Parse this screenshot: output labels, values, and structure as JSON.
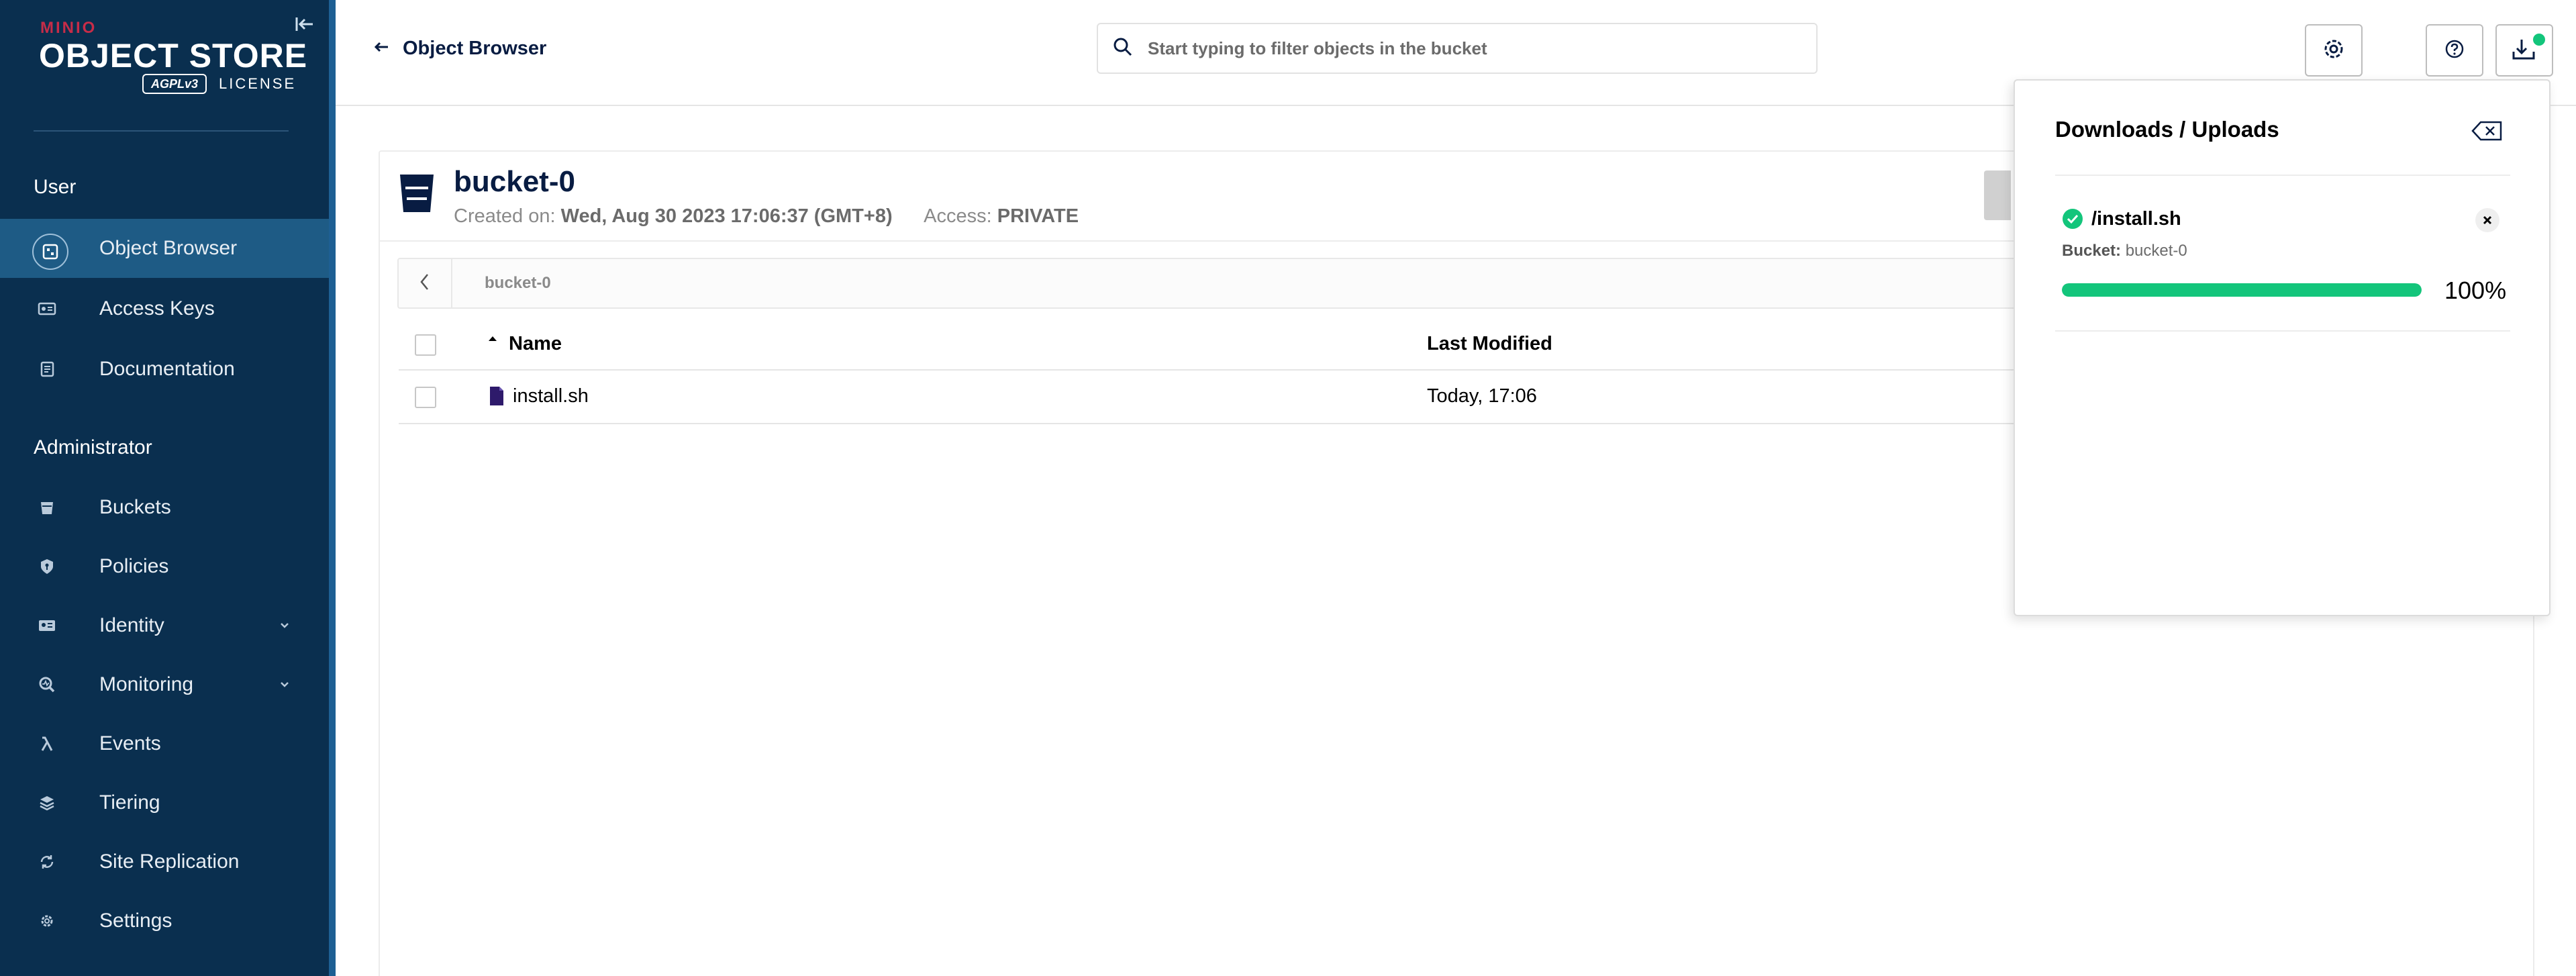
{
  "brand": {
    "vendor": "MINIO",
    "product": "OBJECT STORE",
    "license_badge": "AGPLv3",
    "license_label": "LICENSE"
  },
  "sidebar": {
    "sections": [
      {
        "title": "User",
        "items": [
          {
            "label": "Object Browser",
            "icon": "object-browser-icon",
            "active": true
          },
          {
            "label": "Access Keys",
            "icon": "access-keys-icon"
          },
          {
            "label": "Documentation",
            "icon": "documentation-icon"
          }
        ]
      },
      {
        "title": "Administrator",
        "items": [
          {
            "label": "Buckets",
            "icon": "bucket-icon"
          },
          {
            "label": "Policies",
            "icon": "shield-icon"
          },
          {
            "label": "Identity",
            "icon": "identity-icon",
            "expandable": true
          },
          {
            "label": "Monitoring",
            "icon": "monitoring-icon",
            "expandable": true
          },
          {
            "label": "Events",
            "icon": "lambda-icon"
          },
          {
            "label": "Tiering",
            "icon": "tiering-icon"
          },
          {
            "label": "Site Replication",
            "icon": "replication-icon"
          },
          {
            "label": "Settings",
            "icon": "gear-icon"
          }
        ]
      }
    ]
  },
  "topbar": {
    "back_label": "Object Browser",
    "search_placeholder": "Start typing to filter objects in the bucket"
  },
  "bucket": {
    "name": "bucket-0",
    "created_label": "Created on:",
    "created_value": "Wed, Aug 30 2023 17:06:37 (GMT+8)",
    "access_label": "Access:",
    "access_value": "PRIVATE"
  },
  "breadcrumb": {
    "path": "bucket-0"
  },
  "table": {
    "columns": {
      "name": "Name",
      "modified": "Last Modified"
    },
    "rows": [
      {
        "name": "install.sh",
        "modified": "Today, 17:06"
      }
    ]
  },
  "downloads_panel": {
    "title": "Downloads / Uploads",
    "items": [
      {
        "name": "/install.sh",
        "bucket_label": "Bucket:",
        "bucket": "bucket-0",
        "progress_percent": 100,
        "progress_text": "100%",
        "status": "complete"
      }
    ]
  },
  "colors": {
    "sidebar_bg": "#0a2f4f",
    "sidebar_active": "#1e5b85",
    "accent_green": "#13c57b",
    "brand_red": "#c72c48",
    "text_dark": "#081c42"
  }
}
